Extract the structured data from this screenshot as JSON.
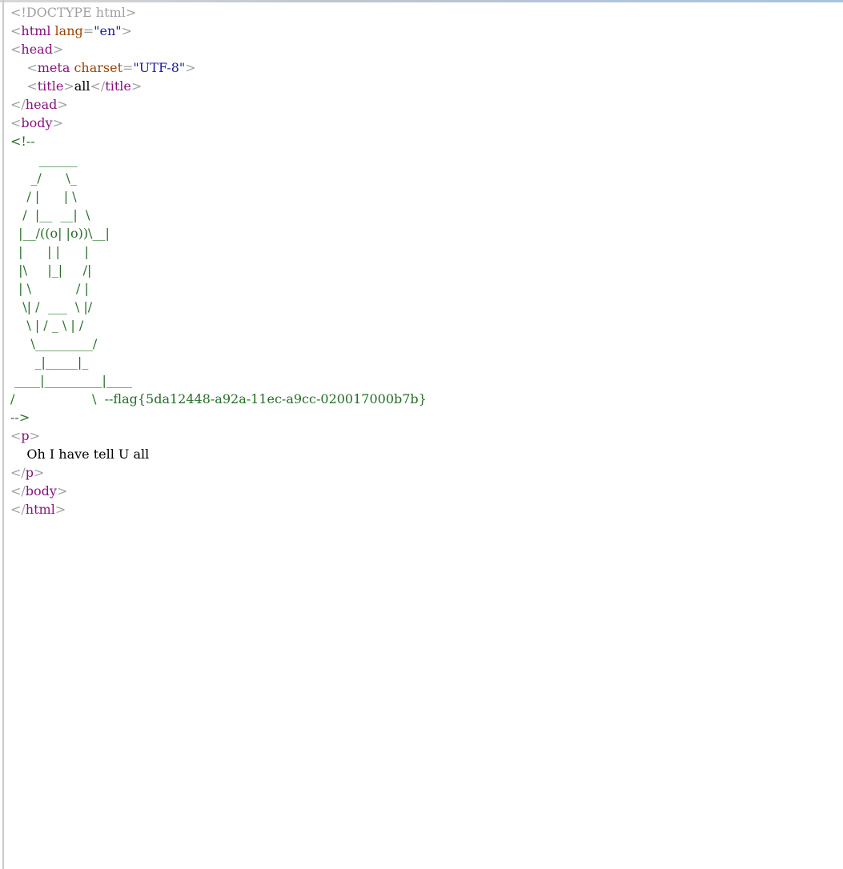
{
  "source": {
    "doctype": "<!DOCTYPE html>",
    "html_open": {
      "lt": "<",
      "name": "html",
      "attr": "lang",
      "eq": "=",
      "value": "\"en\"",
      "gt": ">"
    },
    "head_open": {
      "lt": "<",
      "name": "head",
      "gt": ">"
    },
    "meta": {
      "indent": "    ",
      "lt": "<",
      "name": "meta",
      "attr": "charset",
      "eq": "=",
      "value": "\"UTF-8\"",
      "gt": ">"
    },
    "title": {
      "indent": "    ",
      "open_lt": "<",
      "open_name": "title",
      "open_gt": ">",
      "text": "all",
      "close_lt": "</",
      "close_name": "title",
      "close_gt": ">"
    },
    "head_close": {
      "lt": "</",
      "name": "head",
      "gt": ">"
    },
    "body_open": {
      "lt": "<",
      "name": "body",
      "gt": ">"
    },
    "comment_lines": [
      "<!--",
      "       ______",
      "     _/      \\_",
      "    / |      | \\",
      "   /  |__  __|  \\",
      "  |__/((o| |o))\\__|",
      "  |      | |      |",
      "  |\\     |_|     /|",
      "  | \\           / |",
      "   \\| /  ___  \\ |/",
      "    \\ | / _ \\ | /",
      "     \\_________/",
      "      _|_____|_",
      " ____|_________|____",
      "/                   \\  --flag{5da12448-a92a-11ec-a9cc-020017000b7b}",
      "-->"
    ],
    "p_open": {
      "lt": "<",
      "name": "p",
      "gt": ">"
    },
    "p_text": "    Oh I have tell U all",
    "p_close": {
      "lt": "</",
      "name": "p",
      "gt": ">"
    },
    "body_close": {
      "lt": "</",
      "name": "body",
      "gt": ">"
    },
    "html_close": {
      "lt": "</",
      "name": "html",
      "gt": ">"
    }
  },
  "colors": {
    "tag": "#881280",
    "punctuation": "#a0a0a0",
    "attribute": "#994500",
    "value": "#1a1aa6",
    "comment": "#236e25",
    "text": "#000000"
  }
}
